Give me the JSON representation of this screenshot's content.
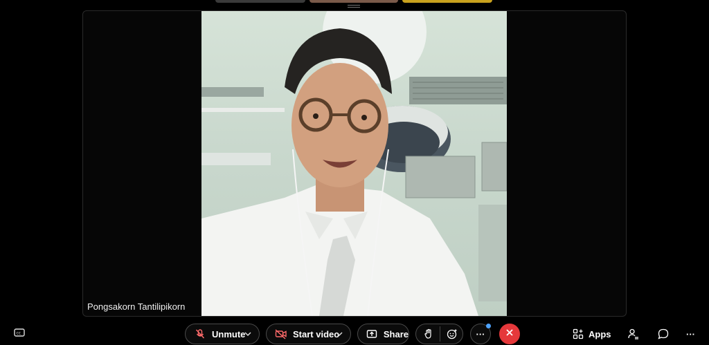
{
  "stage": {
    "participant_name": "Pongsakorn Tantilipikorn"
  },
  "toolbar": {
    "unmute_label": "Unmute",
    "start_video_label": "Start video",
    "share_label": "Share",
    "apps_label": "Apps",
    "more_label": "···",
    "overflow_label": "···"
  },
  "icons": {
    "captions": "captions-icon",
    "mic_muted": "mic-muted-icon",
    "video_off": "video-off-icon",
    "share": "share-icon",
    "raise_hand": "raise-hand-icon",
    "reactions": "reactions-icon",
    "leave": "close-icon",
    "apps": "apps-icon",
    "participants": "participants-icon",
    "chat": "chat-icon"
  },
  "colors": {
    "leave": "#e5383b",
    "muted_icon": "#ff6b6b",
    "notification_dot": "#4ea3ff"
  }
}
